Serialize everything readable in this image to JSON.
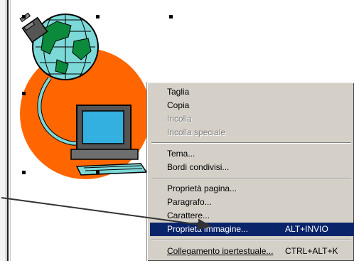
{
  "menu": {
    "items": [
      {
        "label": "Taglia"
      },
      {
        "label": "Copia"
      },
      {
        "label": "Incolla"
      },
      {
        "label": "Incolla speciale"
      },
      {
        "label": "Tema..."
      },
      {
        "label": "Bordi condivisi..."
      },
      {
        "label": "Proprietà pagina..."
      },
      {
        "label": "Paragrafo..."
      },
      {
        "label": "Carattere..."
      },
      {
        "label": "Proprietà immagine...",
        "shortcut": "ALT+INVIO"
      },
      {
        "label": "Collegamento ipertestuale...",
        "shortcut": "CTRL+ALT+K"
      }
    ]
  },
  "colors": {
    "selection": "#0a246a",
    "menu_background": "#d4d0c8",
    "clipart_circle": "#ff6600",
    "globe": "#6fd6d6"
  }
}
